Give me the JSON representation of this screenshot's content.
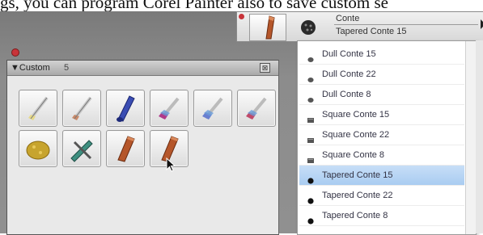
{
  "article": {
    "text": "gs, you can program Corel Painter also to save custom se"
  },
  "palette": {
    "title": "▼Custom",
    "count": "5",
    "close_glyph": "⊠",
    "tiles": [
      {
        "icon": "pencil-brush-icon",
        "color": "#e6d98a"
      },
      {
        "icon": "pencil-brush-icon",
        "color": "#c98a6a"
      },
      {
        "icon": "blue-marker-icon",
        "color": "#3a4db3"
      },
      {
        "icon": "multicolor-brush-icon",
        "color": "#b03a8a"
      },
      {
        "icon": "multicolor-brush-icon",
        "color": "#6a7fd0"
      },
      {
        "icon": "multicolor-brush-icon",
        "color": "#c04a6a"
      },
      {
        "icon": "sponge-icon",
        "color": "#c7a42e"
      },
      {
        "icon": "palette-knife-icon",
        "color": "#3e8f80"
      },
      {
        "icon": "conte-stick-icon",
        "color": "#b5562a"
      },
      {
        "icon": "conte-stick-icon",
        "color": "#b5562a"
      }
    ]
  },
  "selector": {
    "category": "Conte",
    "variant": "Tapered Conte 15",
    "brush_icon": "conte-stick-icon",
    "variant_icon": "dab-preview-icon"
  },
  "variants": [
    {
      "label": "Dull Conte 15",
      "icon": "dull-dab-icon",
      "selected": false
    },
    {
      "label": "Dull Conte 22",
      "icon": "dull-dab-icon",
      "selected": false
    },
    {
      "label": "Dull Conte 8",
      "icon": "dull-dab-icon",
      "selected": false
    },
    {
      "label": "Square Conte 15",
      "icon": "square-dab-icon",
      "selected": false
    },
    {
      "label": "Square Conte 22",
      "icon": "square-dab-icon",
      "selected": false
    },
    {
      "label": "Square Conte 8",
      "icon": "square-dab-icon",
      "selected": false
    },
    {
      "label": "Tapered Conte 15",
      "icon": "tapered-dab-icon",
      "selected": true
    },
    {
      "label": "Tapered Conte 22",
      "icon": "tapered-dab-icon",
      "selected": false
    },
    {
      "label": "Tapered Conte 8",
      "icon": "tapered-dab-icon",
      "selected": false
    }
  ],
  "colors": {
    "selection": "#a9ccf1",
    "close": "#c8343a"
  }
}
